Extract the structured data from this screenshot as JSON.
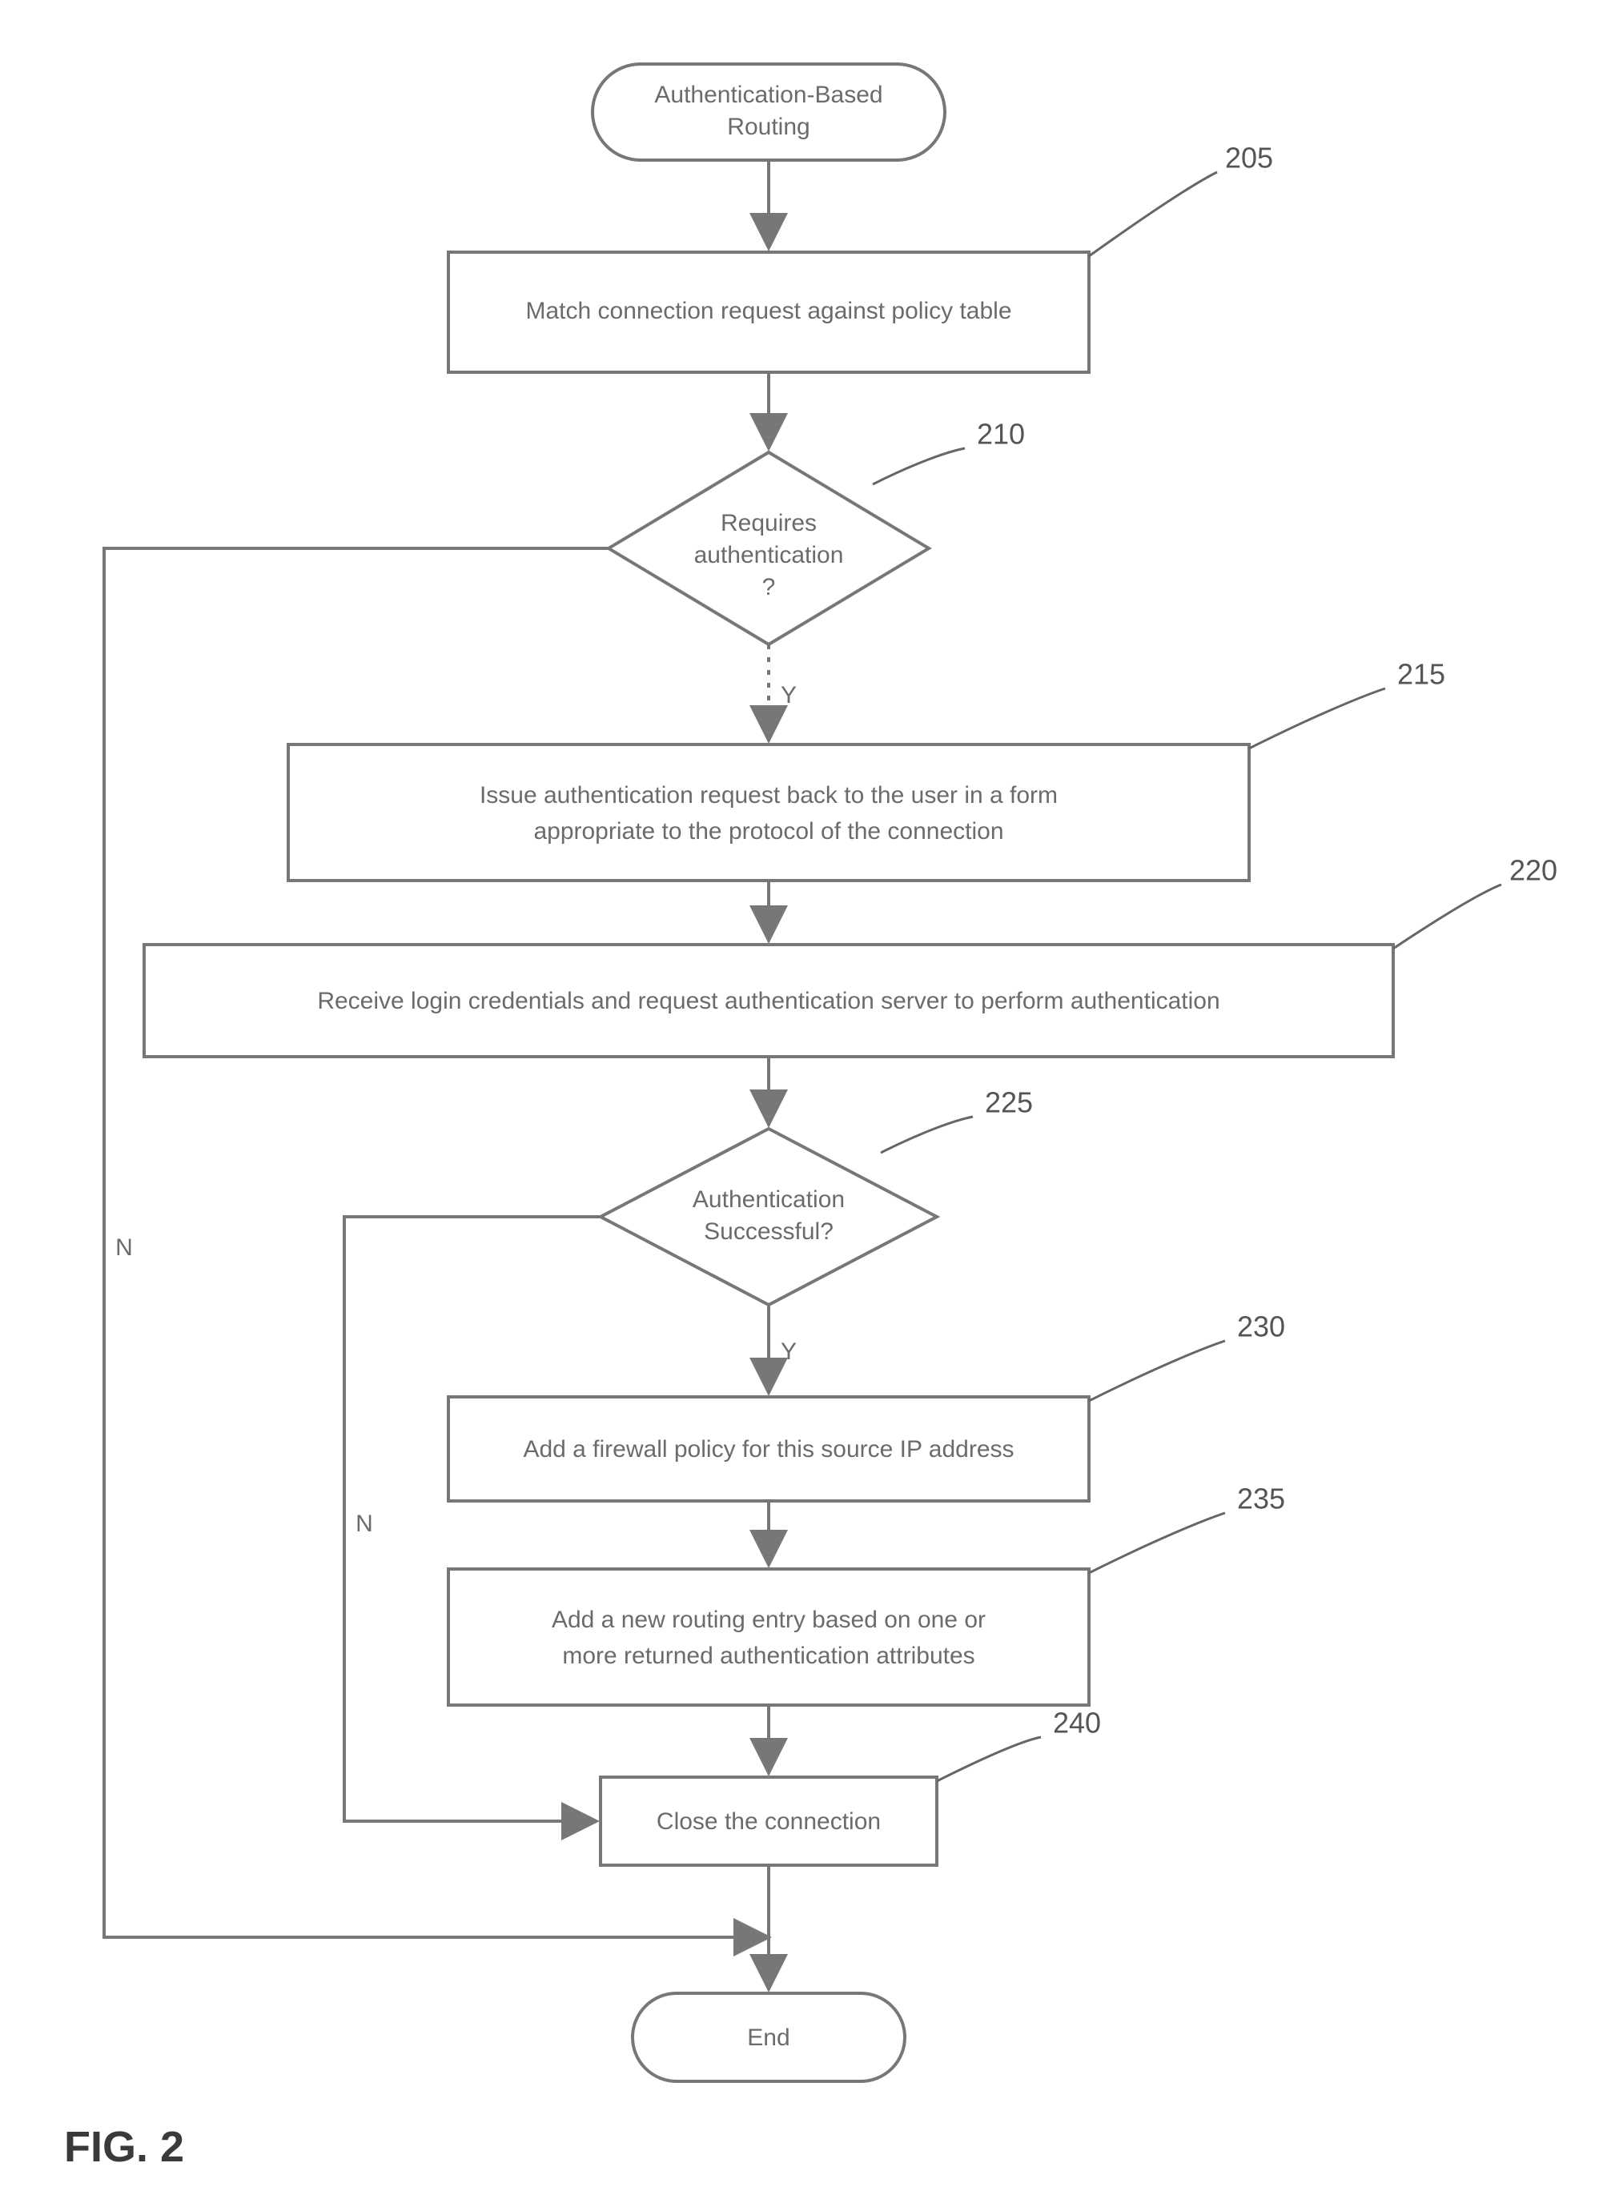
{
  "figure_label": "FIG. 2",
  "nodes": {
    "start": {
      "line1": "Authentication-Based",
      "line2": "Routing"
    },
    "n205": "Match connection request against policy table",
    "d210": {
      "line1": "Requires",
      "line2": "authentication",
      "line3": "?"
    },
    "n215": {
      "line1": "Issue authentication request back to the user in a form",
      "line2": "appropriate to the protocol of the connection"
    },
    "n220": "Receive login credentials and request authentication server to perform authentication",
    "d225": {
      "line1": "Authentication",
      "line2": "Successful?"
    },
    "n230": "Add a firewall policy for this source IP address",
    "n235": {
      "line1": "Add a new routing entry based on one or",
      "line2": "more returned authentication attributes"
    },
    "n240": "Close the connection",
    "end": "End"
  },
  "refs": {
    "r205": "205",
    "r210": "210",
    "r215": "215",
    "r220": "220",
    "r225": "225",
    "r230": "230",
    "r235": "235",
    "r240": "240"
  },
  "edges": {
    "y1": "Y",
    "y2": "Y",
    "n1": "N",
    "n2": "N"
  }
}
